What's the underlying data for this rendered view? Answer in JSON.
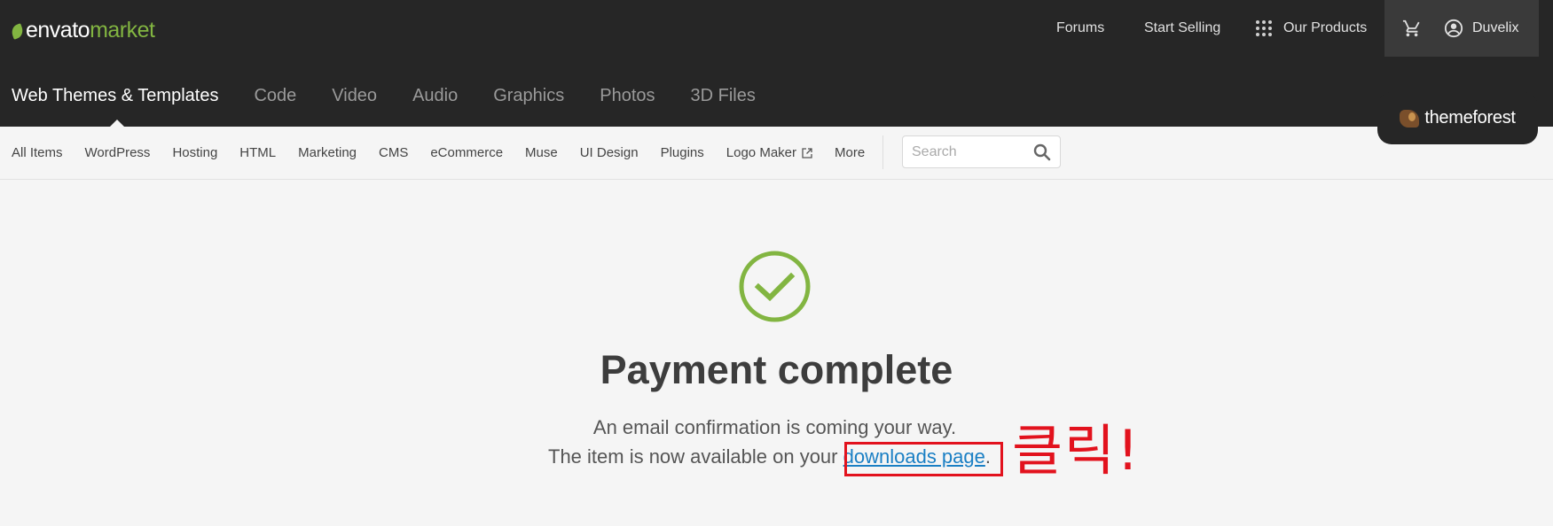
{
  "brand": {
    "word1": "envato",
    "word2": "market"
  },
  "top_nav": {
    "forums": "Forums",
    "start_selling": "Start Selling",
    "our_products": "Our Products"
  },
  "user": {
    "name": "Duvelix"
  },
  "categories": [
    {
      "label": "Web Themes & Templates",
      "active": true
    },
    {
      "label": "Code"
    },
    {
      "label": "Video"
    },
    {
      "label": "Audio"
    },
    {
      "label": "Graphics"
    },
    {
      "label": "Photos"
    },
    {
      "label": "3D Files"
    }
  ],
  "marketplace_badge": "themeforest",
  "subnav": {
    "items": [
      "All Items",
      "WordPress",
      "Hosting",
      "HTML",
      "Marketing",
      "CMS",
      "eCommerce",
      "Muse",
      "UI Design",
      "Plugins",
      "Logo Maker",
      "More"
    ],
    "search_placeholder": "Search"
  },
  "main": {
    "title": "Payment complete",
    "line1": "An email confirmation is coming your way.",
    "line2_prefix": "The item is now available on your ",
    "line2_link": "downloads page",
    "line2_suffix": "."
  },
  "annotation": {
    "text": "클릭!",
    "color": "#e2121d"
  },
  "colors": {
    "header_bg": "#262626",
    "brand_green": "#82b541",
    "link_blue": "#1a7fc4",
    "annotation_red": "#e2121d"
  }
}
